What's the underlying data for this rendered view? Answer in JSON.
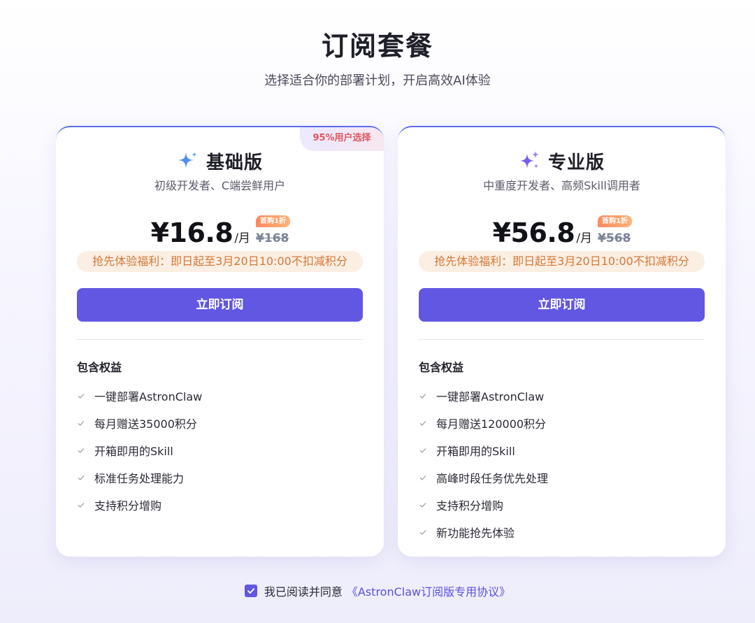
{
  "header": {
    "title": "订阅套餐",
    "subtitle": "选择适合你的部署计划，开启高效AI体验"
  },
  "plans": [
    {
      "badge": "95%用户选择",
      "icon": "sparkle-icon",
      "icon_color": "#4f8ef7",
      "name": "基础版",
      "description": "初级开发者、C端尝鲜用户",
      "price": "¥16.8",
      "price_unit": "/月",
      "discount_tag": "首购1折",
      "original_price": "¥168",
      "benefit": "抢先体验福利：即日起至3月20日10:00不扣减积分",
      "cta_label": "立即订阅",
      "features_title": "包含权益",
      "features": [
        "一键部署AstronClaw",
        "每月赠送35000积分",
        "开箱即用的Skill",
        "标准任务处理能力",
        "支持积分增购"
      ]
    },
    {
      "icon": "sparkles-icon",
      "icon_color": "#7b5cf0",
      "name": "专业版",
      "description": "中重度开发者、高频Skill调用者",
      "price": "¥56.8",
      "price_unit": "/月",
      "discount_tag": "首购1折",
      "original_price": "¥568",
      "benefit": "抢先体验福利：即日起至3月20日10:00不扣减积分",
      "cta_label": "立即订阅",
      "features_title": "包含权益",
      "features": [
        "一键部署AstronClaw",
        "每月赠送120000积分",
        "开箱即用的Skill",
        "高峰时段任务优先处理",
        "支持积分增购",
        "新功能抢先体验"
      ]
    }
  ],
  "agreement": {
    "checked": true,
    "text": "我已阅读并同意",
    "link_text": "《AstronClaw订阅版专用协议》"
  },
  "colors": {
    "primary": "#6157e3",
    "benefit_bg": "#fbeee3",
    "benefit_text": "#d77837",
    "badge_text": "#e0565f",
    "card_top_border": "#5b6cf0"
  }
}
